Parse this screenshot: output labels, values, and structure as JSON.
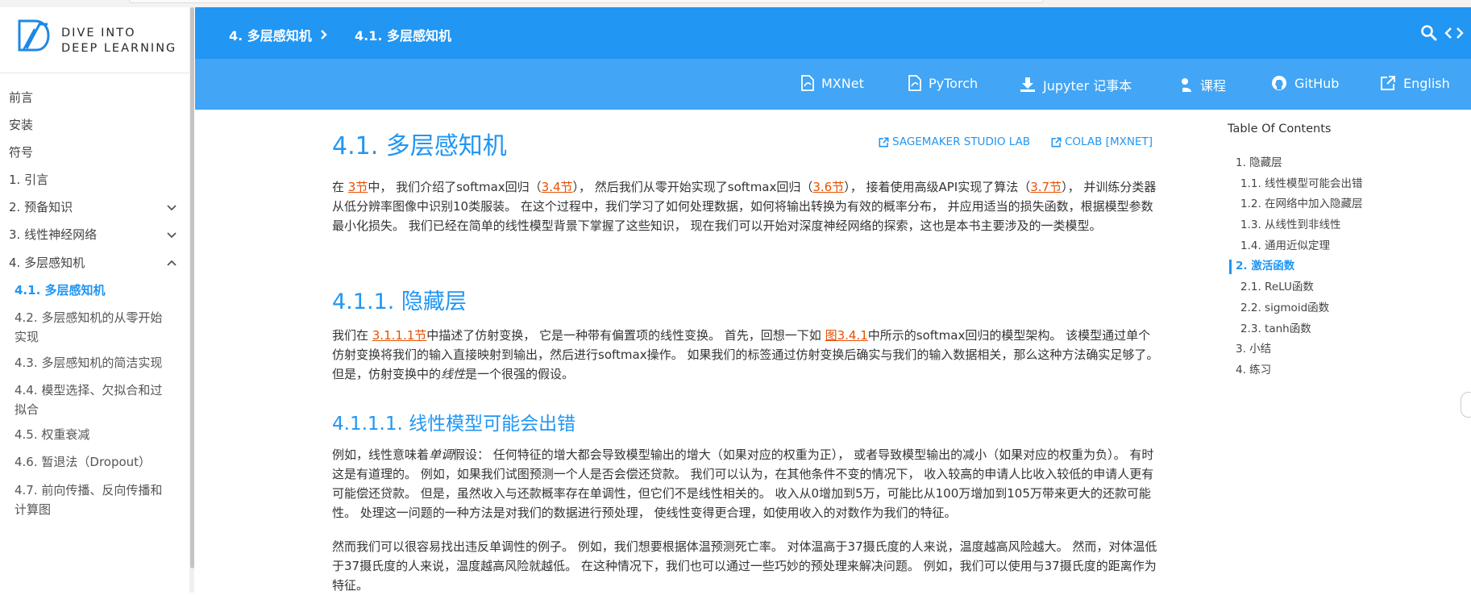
{
  "logo": {
    "line1": "DIVE INTO",
    "line2": "DEEP LEARNING"
  },
  "sidebar": {
    "items": [
      {
        "label": "前言",
        "sub": false,
        "active": false,
        "chevron": ""
      },
      {
        "label": "安装",
        "sub": false,
        "active": false,
        "chevron": ""
      },
      {
        "label": "符号",
        "sub": false,
        "active": false,
        "chevron": ""
      },
      {
        "label": "1. 引言",
        "sub": false,
        "active": false,
        "chevron": ""
      },
      {
        "label": "2. 预备知识",
        "sub": false,
        "active": false,
        "chevron": "down"
      },
      {
        "label": "3. 线性神经网络",
        "sub": false,
        "active": false,
        "chevron": "down"
      },
      {
        "label": "4. 多层感知机",
        "sub": false,
        "active": false,
        "chevron": "up"
      },
      {
        "label": "4.1. 多层感知机",
        "sub": true,
        "active": true,
        "chevron": ""
      },
      {
        "label": "4.2. 多层感知机的从零开始实现",
        "sub": true,
        "active": false,
        "chevron": ""
      },
      {
        "label": "4.3. 多层感知机的简洁实现",
        "sub": true,
        "active": false,
        "chevron": ""
      },
      {
        "label": "4.4. 模型选择、欠拟合和过拟合",
        "sub": true,
        "active": false,
        "chevron": ""
      },
      {
        "label": "4.5. 权重衰减",
        "sub": true,
        "active": false,
        "chevron": ""
      },
      {
        "label": "4.6. 暂退法（Dropout）",
        "sub": true,
        "active": false,
        "chevron": ""
      },
      {
        "label": "4.7. 前向传播、反向传播和计算图",
        "sub": true,
        "active": false,
        "chevron": ""
      }
    ]
  },
  "header": {
    "breadcrumb": [
      "4. 多层感知机",
      "4.1. 多层感知机"
    ],
    "links": [
      {
        "label": "MXNet",
        "icon": "pdf-icon"
      },
      {
        "label": "PyTorch",
        "icon": "pdf-icon"
      },
      {
        "label": "Jupyter 记事本",
        "icon": "download-icon"
      },
      {
        "label": "课程",
        "icon": "teacher-icon"
      },
      {
        "label": "GitHub",
        "icon": "github-icon"
      },
      {
        "label": "English",
        "icon": "external-link-icon"
      }
    ]
  },
  "content": {
    "title": "4.1. 多层感知机",
    "sagemaker": "SAGEMAKER STUDIO LAB",
    "colab": "COLAB [MXNET]",
    "intro": [
      "在 ",
      "3节",
      "中， 我们介绍了softmax回归（",
      "3.4节",
      "）， 然后我们从零开始实现了softmax回归（",
      "3.6节",
      "）， 接着使用高级API实现了算法（",
      "3.7节",
      "）， 并训练分类器从低分辨率图像中识别10类服装。 在这个过程中，我们学习了如何处理数据，如何将输出转换为有效的概率分布， 并应用适当的损失函数，根据模型参数最小化损失。 我们已经在简单的线性模型背景下掌握了这些知识， 现在我们可以开始对深度神经网络的探索，这也是本书主要涉及的一类模型。"
    ],
    "h2": "4.1.1. 隐藏层",
    "p2": [
      "我们在 ",
      "3.1.1.1节",
      "中描述了仿射变换， 它是一种带有偏置项的线性变换。 首先，回想一下如 ",
      "图3.4.1",
      "中所示的softmax回归的模型架构。 该模型通过单个仿射变换将我们的输入直接映射到输出，然后进行softmax操作。 如果我们的标签通过仿射变换后确实与我们的输入数据相关，那么这种方法确实足够了。 但是，仿射变换中的",
      "线性",
      "是一个很强的假设。"
    ],
    "h3": "4.1.1.1. 线性模型可能会出错",
    "p3": [
      "例如，线性意味着",
      "单调",
      "假设： 任何特征的增大都会导致模型输出的增大（如果对应的权重为正）， 或者导致模型输出的减小（如果对应的权重为负）。 有时这是有道理的。 例如，如果我们试图预测一个人是否会偿还贷款。 我们可以认为，在其他条件不变的情况下， 收入较高的申请人比收入较低的申请人更有可能偿还贷款。 但是，虽然收入与还款概率存在单调性，但它们不是线性相关的。 收入从0增加到5万，可能比从100万增加到105万带来更大的还款可能性。 处理这一问题的一种方法是对我们的数据进行预处理， 使线性变得更合理，如使用收入的对数作为我们的特征。"
    ],
    "p4": "然而我们可以很容易找出违反单调性的例子。 例如，我们想要根据体温预测死亡率。 对体温高于37摄氏度的人来说，温度越高风险越大。 然而，对体温低于37摄氏度的人来说，温度越高风险就越低。 在这种情况下，我们也可以通过一些巧妙的预处理来解决问题。 例如，我们可以使用与37摄氏度的距离作为特征。"
  },
  "toc": {
    "title": "Table Of Contents",
    "items": [
      {
        "label": "1. 隐藏层",
        "level": 1,
        "active": false
      },
      {
        "label": "1.1. 线性模型可能会出错",
        "level": 2,
        "active": false
      },
      {
        "label": "1.2. 在网络中加入隐藏层",
        "level": 2,
        "active": false
      },
      {
        "label": "1.3. 从线性到非线性",
        "level": 2,
        "active": false
      },
      {
        "label": "1.4. 通用近似定理",
        "level": 2,
        "active": false
      },
      {
        "label": "2. 激活函数",
        "level": 1,
        "active": true
      },
      {
        "label": "2.1. ReLU函数",
        "level": 2,
        "active": false
      },
      {
        "label": "2.2. sigmoid函数",
        "level": 2,
        "active": false
      },
      {
        "label": "2.3. tanh函数",
        "level": 2,
        "active": false
      },
      {
        "label": "3. 小结",
        "level": 1,
        "active": false
      },
      {
        "label": "4. 练习",
        "level": 1,
        "active": false
      }
    ]
  },
  "colors": {
    "primary": "#2196f3",
    "header2": "#42a5f5",
    "link": "#e65100"
  }
}
